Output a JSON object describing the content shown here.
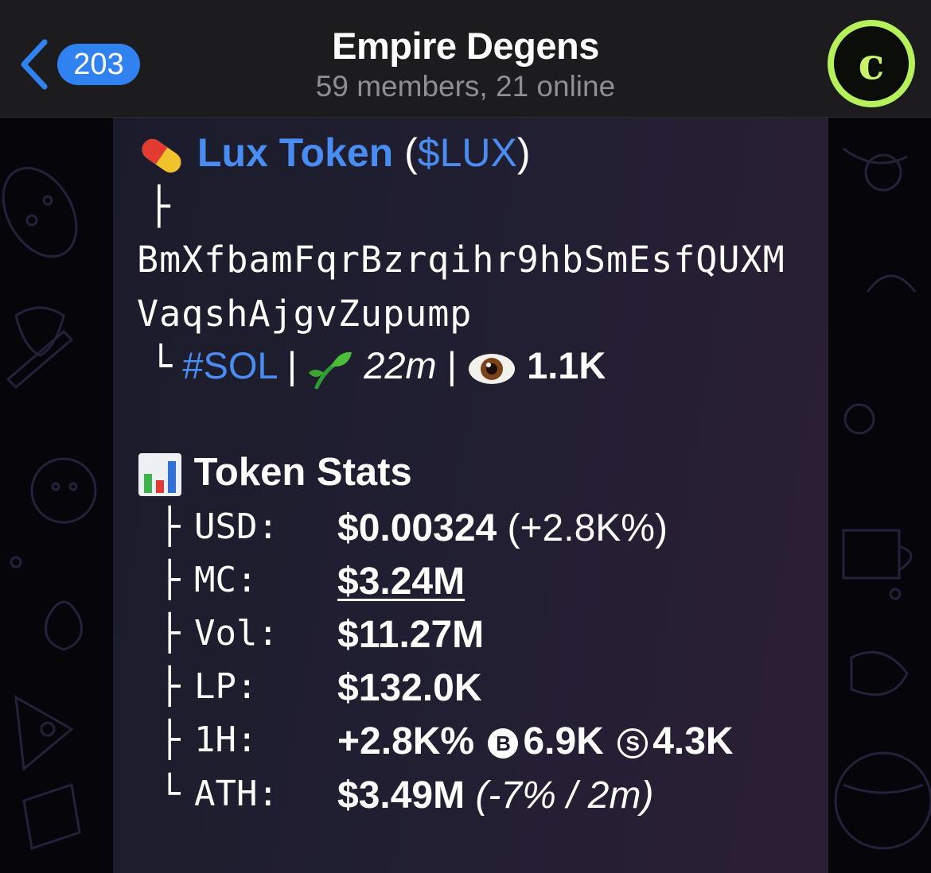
{
  "header": {
    "unread_count": "203",
    "title": "Empire Degens",
    "subtitle": "59 members, 21 online",
    "avatar_letter": "c"
  },
  "message": {
    "token_name": "Lux Token",
    "ticker_open": "(",
    "ticker": "$LUX",
    "ticker_close": ")",
    "tree_branch": "├",
    "address_line1": "BmXfbamFqrBzrqihr9hbSmEsfQUXM",
    "address_line2": "VaqshAjgvZupump",
    "tree_end": "└",
    "chain_tag": "#SOL",
    "separator": "|",
    "age": "22m",
    "views": "1.1K",
    "stats_title": "Token Stats",
    "stats": [
      {
        "branch": "├",
        "label": "USD:",
        "value": "$0.00324",
        "extra": " (+2.8K%)"
      },
      {
        "branch": "├",
        "label": "MC:",
        "value": "$3.24M"
      },
      {
        "branch": "├",
        "label": "Vol:",
        "value": "$11.27M"
      },
      {
        "branch": "├",
        "label": "LP:",
        "value": "$132.0K"
      },
      {
        "branch": "├",
        "label": "1H:",
        "value": "+2.8K%",
        "buys_icon": "B",
        "buys": "6.9K",
        "sells_icon": "S",
        "sells": "4.3K"
      },
      {
        "branch": "└",
        "label": "ATH:",
        "value": "$3.49M",
        "extra": " (-7% / 2m)"
      }
    ]
  },
  "icons": {
    "back": "chevron-left-icon",
    "pill": "pill-emoji-icon",
    "seedling": "seedling-emoji-icon",
    "eye": "eye-emoji-icon",
    "chart": "bar-chart-emoji-icon"
  },
  "colors": {
    "accent": "#2f82f0",
    "link": "#4a8df2",
    "avatar_ring": "#b6f05a",
    "header_bg": "#1c1c1e"
  }
}
